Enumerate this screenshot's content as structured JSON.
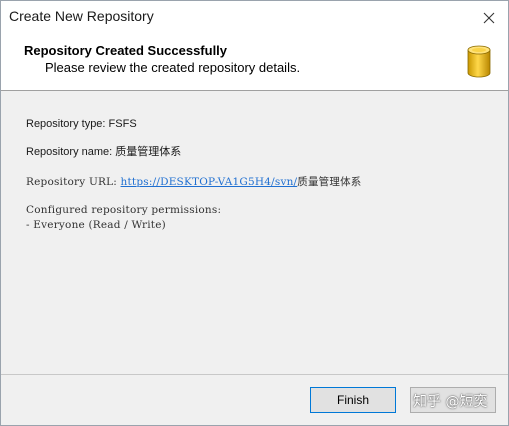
{
  "window": {
    "title": "Create New Repository",
    "close_icon": "close-icon"
  },
  "header": {
    "title": "Repository Created Successfully",
    "subtitle": "Please review the created repository details.",
    "icon": "database-icon",
    "icon_color": "#e8b400"
  },
  "details": {
    "type_label": "Repository type: ",
    "type_value": "FSFS",
    "name_label": "Repository name: ",
    "name_value": "质量管理体系",
    "url_label": "Repository URL: ",
    "url_link": "https://DESKTOP-VA1G5H4/svn/",
    "url_suffix": "质量管理体系",
    "permissions_label": "Configured repository permissions:",
    "permissions_entry": "- Everyone (Read / Write)"
  },
  "footer": {
    "finish_label": "Finish",
    "watermark": "知乎 @短奕"
  },
  "colors": {
    "accent": "#0078d7",
    "link": "#1f6fd1"
  }
}
